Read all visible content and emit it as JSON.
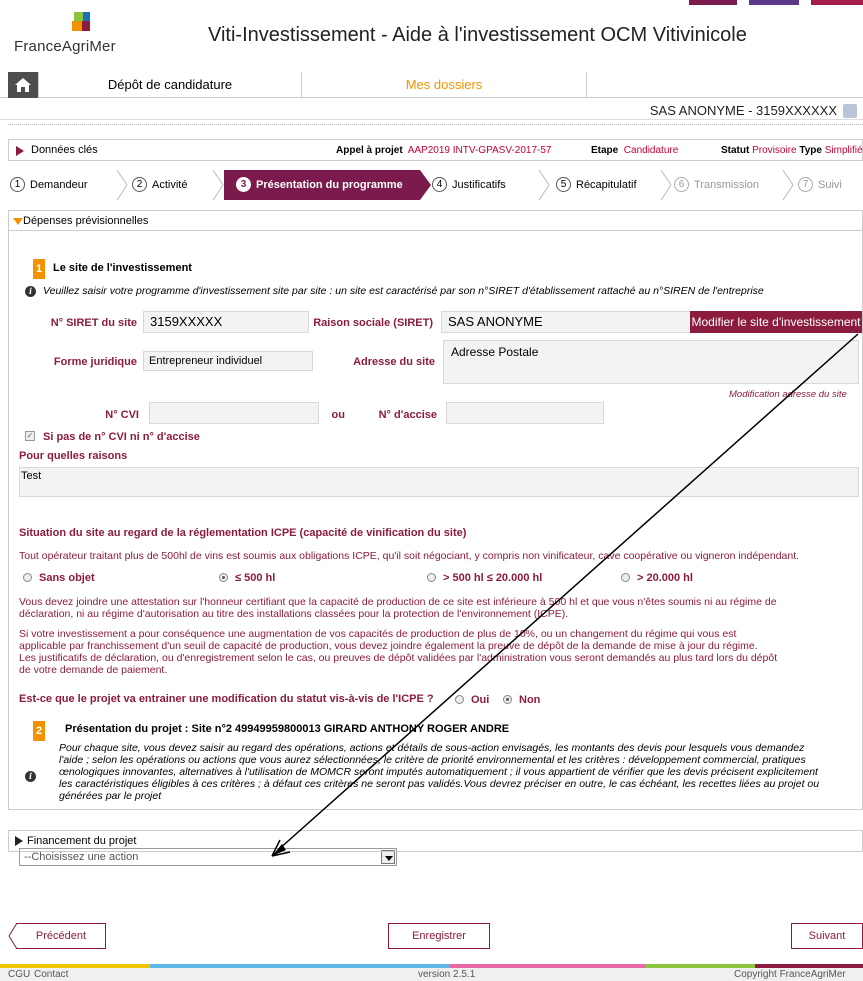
{
  "header": {
    "logo_text": "FranceAgriMer",
    "title": "Viti-Investissement - Aide à l'investissement OCM Vitivinicole",
    "top_colors": [
      "#7b1a4c",
      "#5b3a8c",
      "#a31c4a"
    ]
  },
  "nav": {
    "home_icon": "home-icon",
    "items": [
      {
        "label": "Dépôt de candidature"
      },
      {
        "label": "Mes dossiers"
      }
    ],
    "accent_color": "#f39200"
  },
  "user": {
    "name": "SAS ANONYME - 3159XXXXXX"
  },
  "cles": {
    "label": "Données clés",
    "appel_label": "Appel à projet",
    "appel_value": "AAP2019 INTV-GPASV-2017-57",
    "etape_label": "Etape",
    "etape_value": "Candidature",
    "statut_label": "Statut",
    "statut_value": "Provisoire",
    "type_label": "Type",
    "type_value": "Simplifiée"
  },
  "steps": [
    {
      "num": "1",
      "label": "Demandeur"
    },
    {
      "num": "2",
      "label": "Activité"
    },
    {
      "num": "3",
      "label": "Présentation du programme"
    },
    {
      "num": "4",
      "label": "Justificatifs"
    },
    {
      "num": "5",
      "label": "Récapitulatif"
    },
    {
      "num": "6",
      "label": "Transmission"
    },
    {
      "num": "7",
      "label": "Suivi"
    }
  ],
  "panel": {
    "title": "Dépenses prévisionnelles",
    "section1": {
      "num": "1",
      "title": "Le site de l'investissement",
      "info": "Veuillez saisir votre programme d'investissement site par site : un site est caractérisé par son n°SIRET d'établissement rattaché au n°SIREN de l'entreprise",
      "siret_label": "N° SIRET du site",
      "siret_value": "3159XXXXX",
      "raison_label": "Raison sociale (SIRET)",
      "raison_value": "SAS ANONYME",
      "modify_site_btn": "Modifier le site d'investissement",
      "forme_label": "Forme juridique",
      "forme_value": "Entrepreneur individuel",
      "adresse_label": "Adresse du site",
      "adresse_value": "Adresse Postale",
      "modif_adresse_link": "Modification adresse du site",
      "cvi_label": "N° CVI",
      "ou": "ou",
      "accise_label": "N° d'accise",
      "no_cvi_label": "Si pas de n° CVI ni n° d'accise",
      "raisons_label": "Pour quelles raisons",
      "raisons_value": "Test",
      "icpe_title": "Situation du site au regard de la réglementation ICPE (capacité de vinification du site)",
      "icpe_text": "Tout opérateur traitant plus de 500hl de vins est soumis aux obligations ICPE, qu'il soit négociant, y compris non vinificateur, cave coopérative ou vigneron indépendant.",
      "radio_options": [
        "Sans objet",
        "≤ 500 hl",
        "> 500 hl ≤ 20.000 hl",
        "> 20.000 hl"
      ],
      "selected_option": 1,
      "para1_l1": "Vous devez joindre une attestation sur l'honneur certifiant que la capacité de production de ce site est inférieure à 500 hl et que vous n'êtes soumis ni au régime de",
      "para1_l2": "déclaration, ni au régime d'autorisation au titre des installations classées pour la protection de l'environnement (ICPE).",
      "para2_l1": "Si votre investissement a pour conséquence une augmentation de vos capacités de production de plus de 10%, ou un changement du régime qui vous est",
      "para2_l2": "applicable par franchissement d'un seuil de capacité de production, vous devez joindre également la preuve de dépôt de la demande de mise à jour du régime.",
      "para2_l3": "Les justificatifs de déclaration, ou d'enregistrement selon le cas, ou preuves de dépôt validées par l'administration vous seront demandés au plus tard lors du dépôt",
      "para2_l4": "de votre demande de paiement.",
      "question": "Est-ce que le projet va entrainer une modification du statut vis-à-vis de l'ICPE ?",
      "oui": "Oui",
      "non": "Non"
    },
    "section2": {
      "num": "2",
      "title": "Présentation du projet : Site n°2 49949959800013 GIRARD ANTHONY ROGER ANDRE",
      "info_l1": "Pour chaque site, vous devez saisir au regard des opérations, actions et détails de sous-action envisagés, les montants des devis pour lesquels vous demandez",
      "info_l2": "l'aide ; selon les opérations ou actions que vous aurez sélectionnées, le critère de priorité environnemental et les critères : développement commercial, pratiques",
      "info_l3": "œnologiques innovantes, alternatives à l'utilisation de MOMCR seront imputés automatiquement ; il vous appartient de vérifier que les devis précisent explicitement",
      "info_l4": "les caractéristiques éligibles à ces critères ; à défaut ces critères ne seront pas validés.Vous devrez préciser en outre, le cas échéant, les recettes liées au projet ou",
      "info_l5": "générées par le projet",
      "select_value": "--Choisissez une action"
    }
  },
  "financement": {
    "label": "Financement du projet"
  },
  "buttons": {
    "precedent": "Précédent",
    "enregistrer": "Enregistrer",
    "suivant": "Suivant"
  },
  "footer": {
    "cgu": "CGU",
    "contact": "Contact",
    "version": "version 2.5.1",
    "copyright": "Copyright FranceAgriMer",
    "colors": [
      "#f0c400",
      "#5db7e6",
      "#e86aa5",
      "#8bc53f",
      "#8c1c3e"
    ]
  }
}
